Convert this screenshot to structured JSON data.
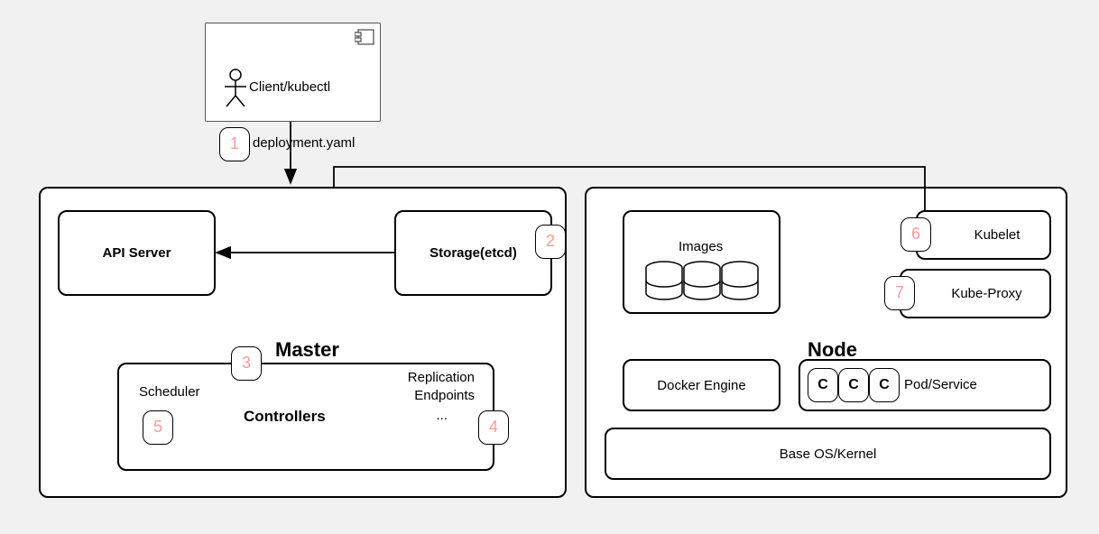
{
  "client": {
    "label": "Client/kubectl"
  },
  "arrow1": {
    "label": "deployment.yaml"
  },
  "master": {
    "title": "Master",
    "api_server": "API Server",
    "storage": "Storage(etcd)",
    "controllers": {
      "title": "Controllers",
      "left": "Scheduler",
      "right1": "Replication",
      "right2": "Endpoints",
      "right3": "..."
    }
  },
  "node": {
    "title": "Node",
    "images": "Images",
    "docker": "Docker Engine",
    "kubelet": "Kubelet",
    "kube_proxy": "Kube-Proxy",
    "pod_service": "Pod/Service",
    "pod_letter": "C",
    "base_os": "Base OS/Kernel"
  },
  "steps": {
    "s1": "1",
    "s2": "2",
    "s3": "3",
    "s4": "4",
    "s5": "5",
    "s6": "6",
    "s7": "7"
  }
}
